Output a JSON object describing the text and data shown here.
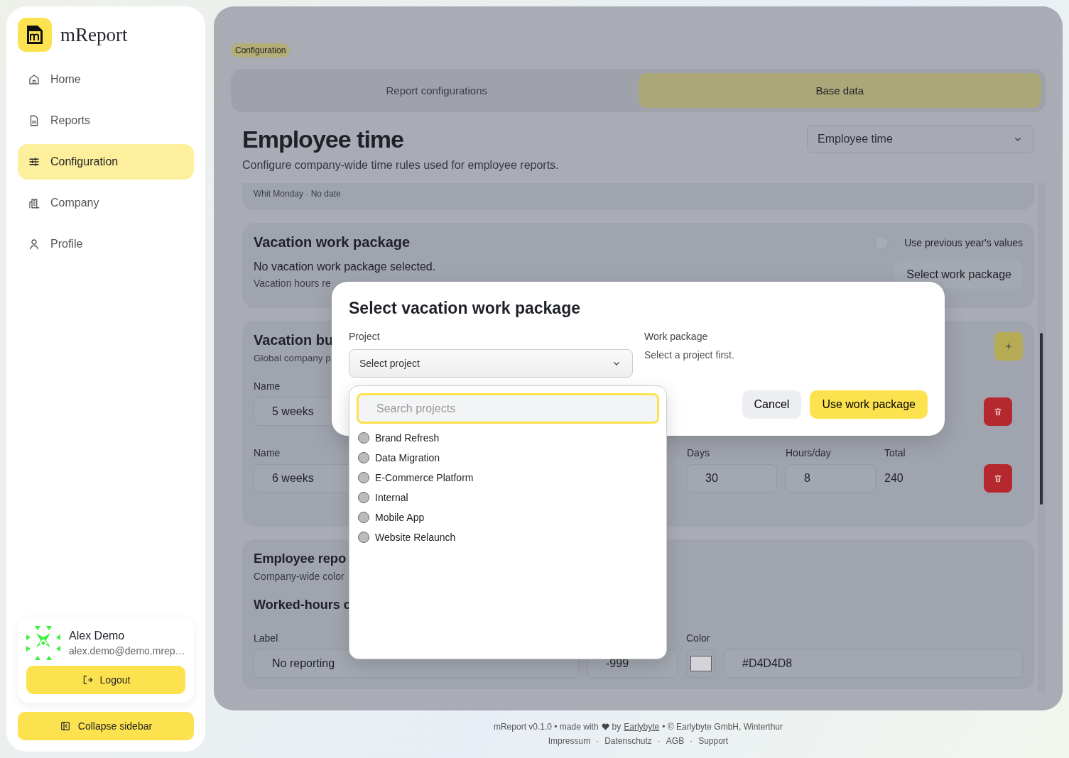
{
  "app": {
    "name": "mReport"
  },
  "nav": [
    {
      "label": "Home",
      "selected": false
    },
    {
      "label": "Reports",
      "selected": false
    },
    {
      "label": "Configuration",
      "selected": true
    },
    {
      "label": "Company",
      "selected": false
    },
    {
      "label": "Profile",
      "selected": false
    }
  ],
  "user": {
    "name": "Alex Demo",
    "email": "alex.demo@demo.mrep…",
    "logout": "Logout"
  },
  "collapse": "Collapse sidebar",
  "breadcrumb": "Configuration",
  "tabs": [
    {
      "label": "Report configurations",
      "selected": false
    },
    {
      "label": "Base data",
      "selected": true
    }
  ],
  "page": {
    "title": "Employee time",
    "subtitle": "Configure company-wide time rules used for employee reports.",
    "select": "Employee time"
  },
  "holidays": {
    "entry": "Whit Monday · No date"
  },
  "vacation_package": {
    "title": "Vacation work package",
    "toggle": {
      "label": "Use previous year's values",
      "on": false
    },
    "message": "No vacation work package selected.",
    "hint": "Vacation hours re",
    "button": "Select work package"
  },
  "vacation_budget": {
    "title": "Vacation bu",
    "subtitle": "Global company p",
    "rows": [
      {
        "labels": [
          "Name"
        ],
        "name": "5 weeks"
      },
      {
        "labels": [
          "Name",
          "Days",
          "Hours/day",
          "Total"
        ],
        "name": "6 weeks",
        "days": "30",
        "hours": "8",
        "total": "240"
      }
    ]
  },
  "employee_report": {
    "title": "Employee repo",
    "subtitle": "Company-wide color",
    "section": "Worked-hours c",
    "labels": [
      "Label",
      "Color"
    ],
    "label_value": "No reporting",
    "threshold": "-999",
    "color": "#d4d4d8",
    "color_text": "#D4D4D8"
  },
  "modal": {
    "title": "Select vacation work package",
    "project_label": "Project",
    "project_placeholder": "Select project",
    "package_label": "Work package",
    "package_hint": "Select a project first.",
    "cancel": "Cancel",
    "confirm": "Use work package",
    "dropdown": {
      "search_placeholder": "Search projects",
      "options": [
        {
          "label": "Brand Refresh",
          "selected": false
        },
        {
          "label": "Data Migration",
          "selected": false
        },
        {
          "label": "E-Commerce Platform",
          "selected": false
        },
        {
          "label": "Internal",
          "selected": false
        },
        {
          "label": "Mobile App",
          "selected": false
        },
        {
          "label": "Website Relaunch",
          "selected": false
        }
      ]
    }
  },
  "footer": {
    "version": "mReport v0.1.0 • made with",
    "by": "by",
    "company_link": "Earlybyte",
    "copyright": "• © Earlybyte GmbH, Winterthur",
    "links": [
      "Impressum",
      "Datenschutz",
      "AGB",
      "Support"
    ],
    "separator": "·"
  }
}
